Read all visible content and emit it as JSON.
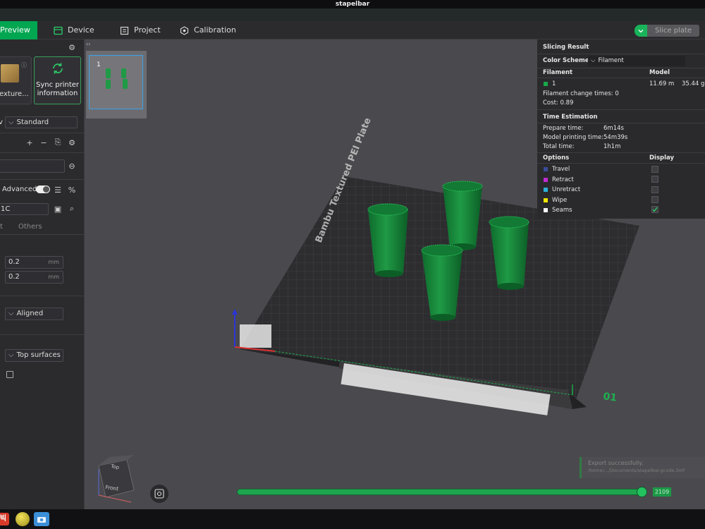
{
  "window": {
    "title": "stapelbar"
  },
  "nav": {
    "tabs": [
      {
        "label": "Preview",
        "active": true
      },
      {
        "label": "Device"
      },
      {
        "label": "Project"
      },
      {
        "label": "Calibration"
      }
    ],
    "slice_label": "Slice plate"
  },
  "sidebar": {
    "plate_label": "exture...",
    "sync_label": "Sync printer information",
    "process_select": "Standard",
    "advanced_label": "Advanced",
    "profile_value": "1C",
    "tab_left": "t",
    "tab_others": "Others",
    "layer_height_1": "0.2",
    "layer_height_2": "0.2",
    "unit_mm": "mm",
    "seam_select": "Aligned",
    "ironing_select": "Top surfaces"
  },
  "plate": {
    "number": "1",
    "bed_label": "Bambu Textured PEI Plate",
    "plate_mark": "01"
  },
  "result": {
    "title": "Slicing Result",
    "color_scheme_label": "Color Scheme",
    "color_scheme_value": "Filament",
    "filament_header": "Filament",
    "model_header": "Model",
    "filament_id": "1",
    "filament_length": "11.69 m",
    "filament_weight": "35.44 g",
    "change_times": "Filament change times:  0",
    "cost": "Cost:  0.89",
    "time_header": "Time Estimation",
    "prepare_label": "Prepare time:",
    "prepare_value": "6m14s",
    "model_time_label": "Model printing time:",
    "model_time_value": "54m39s",
    "total_label": "Total time:",
    "total_value": "1h1m",
    "options_header": "Options",
    "display_header": "Display",
    "options": [
      {
        "label": "Travel",
        "color": "#3b4a9a",
        "checked": false
      },
      {
        "label": "Retract",
        "color": "#c02bd0",
        "checked": false
      },
      {
        "label": "Unretract",
        "color": "#2db1d8",
        "checked": false
      },
      {
        "label": "Wipe",
        "color": "#f2e600",
        "checked": false
      },
      {
        "label": "Seams",
        "color": "#f4f4f4",
        "checked": true
      }
    ],
    "filament_color": "#18a84a"
  },
  "layers": {
    "value": "2109",
    "position": 0.98
  },
  "notification": {
    "title": "Export successfully.",
    "path": "/home/.../Documents/stapelbar.gcode.3mf"
  },
  "colors": {
    "accent": "#00a650",
    "filament": "#1a8f3b"
  }
}
